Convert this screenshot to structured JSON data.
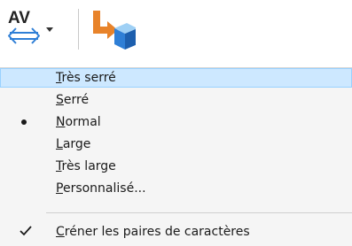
{
  "toolbar": {
    "spacing_icon_text": "AV",
    "buttons": [
      {
        "name": "character-spacing",
        "icon": "character-spacing-icon",
        "has_dropdown": true
      },
      {
        "name": "shape-effects",
        "icon": "shape-arrow-cube-icon",
        "has_dropdown": false
      }
    ]
  },
  "menu": {
    "items": [
      {
        "pre": "",
        "key": "T",
        "post": "rès serré",
        "highlighted": true,
        "selected": false
      },
      {
        "pre": "",
        "key": "S",
        "post": "erré",
        "highlighted": false,
        "selected": false
      },
      {
        "pre": "",
        "key": "N",
        "post": "ormal",
        "highlighted": false,
        "selected": true
      },
      {
        "pre": "",
        "key": "L",
        "post": "arge",
        "highlighted": false,
        "selected": false
      },
      {
        "pre": "",
        "key": "T",
        "post": "rès large",
        "highlighted": false,
        "selected": false
      },
      {
        "pre": "",
        "key": "P",
        "post": "ersonnalisé...",
        "highlighted": false,
        "selected": false
      }
    ],
    "kerning": {
      "pre": "",
      "key": "C",
      "post": "réner les paires de caractères",
      "checked": true
    }
  },
  "colors": {
    "highlight_bg": "#cde8ff",
    "highlight_border": "#99d1ff",
    "menu_bg": "#f5f5f5",
    "icon_blue": "#2f7fd6",
    "icon_orange": "#e8832a"
  }
}
